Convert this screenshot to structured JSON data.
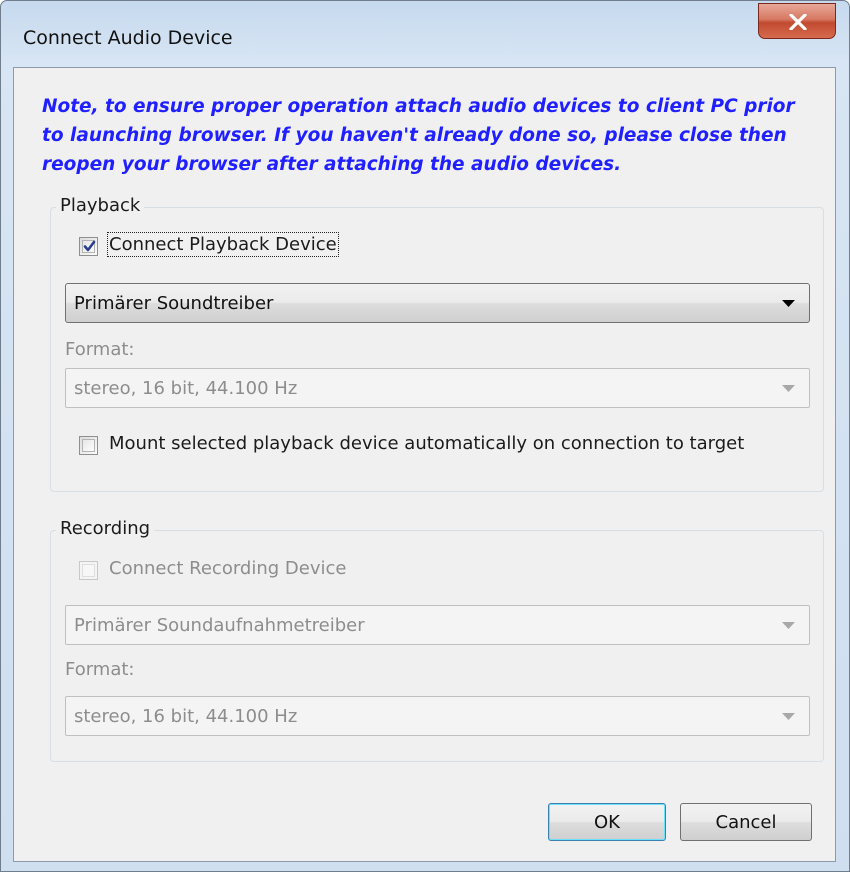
{
  "window": {
    "title": "Connect Audio Device",
    "close_label": "X"
  },
  "note": "Note, to ensure proper operation attach audio devices to client PC prior to launching browser. If you haven't already done so, please close then reopen your browser after attaching the audio devices.",
  "playback": {
    "group_title": "Playback",
    "connect_label": "Connect Playback Device",
    "connect_checked": true,
    "device_value": "Primärer Soundtreiber",
    "format_label": "Format:",
    "format_value": "stereo, 16 bit, 44.100 Hz",
    "mount_label": "Mount selected playback device automatically on connection to target",
    "mount_checked": false
  },
  "recording": {
    "group_title": "Recording",
    "connect_label": "Connect Recording Device",
    "connect_checked": false,
    "device_value": "Primärer Soundaufnahmetreiber",
    "format_label": "Format:",
    "format_value": "stereo, 16 bit, 44.100 Hz"
  },
  "buttons": {
    "ok_label": "OK",
    "cancel_label": "Cancel"
  },
  "colors": {
    "note_text": "#1f1fff",
    "window_frame": "#c6d9ee",
    "client_background": "#f0f0f0",
    "close_button": "#c14a30"
  }
}
